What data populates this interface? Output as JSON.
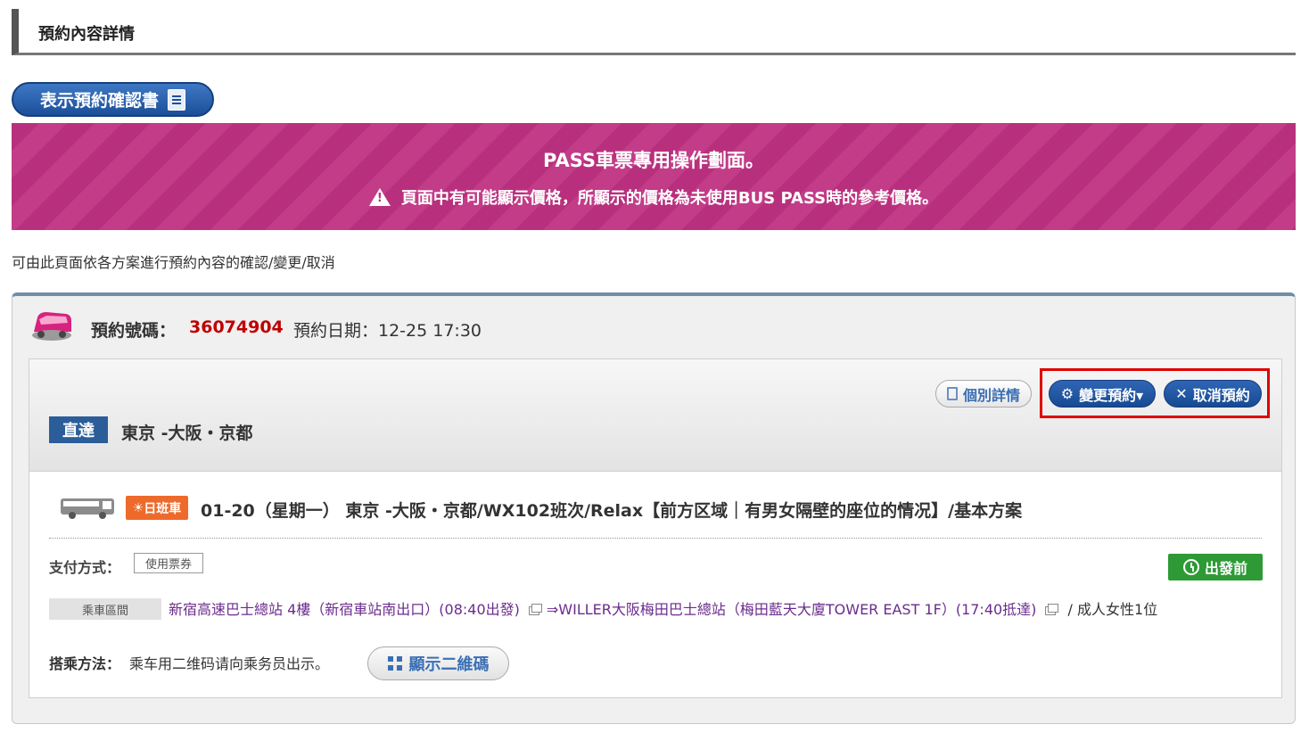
{
  "header": {
    "title": "預約內容詳情"
  },
  "confirm_button": {
    "label": "表示預約確認書"
  },
  "banner": {
    "line1": "PASS車票專用操作劃面。",
    "line2": "頁面中有可能顯示價格，所顯示的價格為未使用BUS PASS時的參考價格。"
  },
  "intro": "可由此頁面依各方案進行預約內容的確認/變更/取消",
  "reservation": {
    "number_label": "預約號碼：",
    "number": "36074904",
    "date_text": "預約日期：12-25 17:30"
  },
  "actions": {
    "detail_label": "個別詳情",
    "change_label": "變更預約▾",
    "cancel_label": "取消預約"
  },
  "route": {
    "badge": "直達",
    "name": "東京 -大阪・京都"
  },
  "trip": {
    "day_badge": "日班車",
    "title": "01-20（星期一） 東京 -大阪・京都/WX102班次/Relax【前方区域｜有男女隔壁的座位的情况】/基本方案"
  },
  "payment": {
    "label": "支付方式：",
    "value": "使用票券"
  },
  "status": {
    "label": "出發前"
  },
  "segment": {
    "label": "乘車區間",
    "from": "新宿高速巴士總站 4樓（新宿車站南出口）(08:40出發)",
    "to": "⇒WILLER大阪梅田巴士總站（梅田藍天大廈TOWER EAST 1F）(17:40抵達)",
    "passengers": "/ 成人女性1位"
  },
  "boarding": {
    "label": "搭乘方法：",
    "text": "乘车用二维码请向乘务员出示。",
    "qr_button": "顯示二維碼"
  },
  "colors": {
    "banner": "#b8307d",
    "reservation_number": "#c00000",
    "primary_button": "#1c4f9a",
    "status_green": "#2e9a36",
    "day_badge": "#ee6a2a",
    "highlight_box": "#e00000"
  }
}
